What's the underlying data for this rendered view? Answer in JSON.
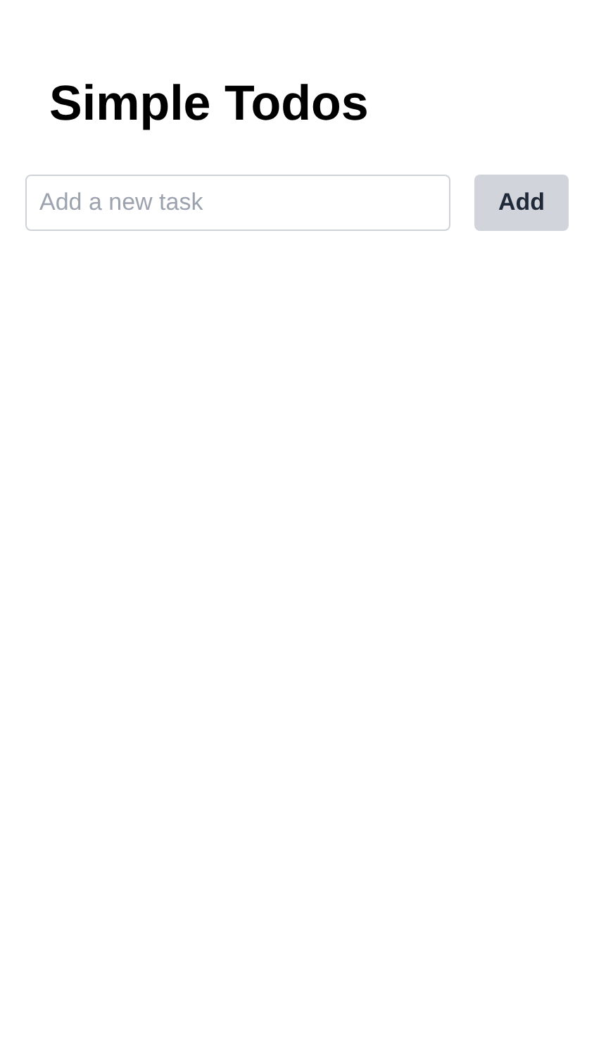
{
  "title": "Simple Todos",
  "new_task": {
    "placeholder": "Add a new task"
  },
  "add_button": {
    "label": "Add"
  }
}
